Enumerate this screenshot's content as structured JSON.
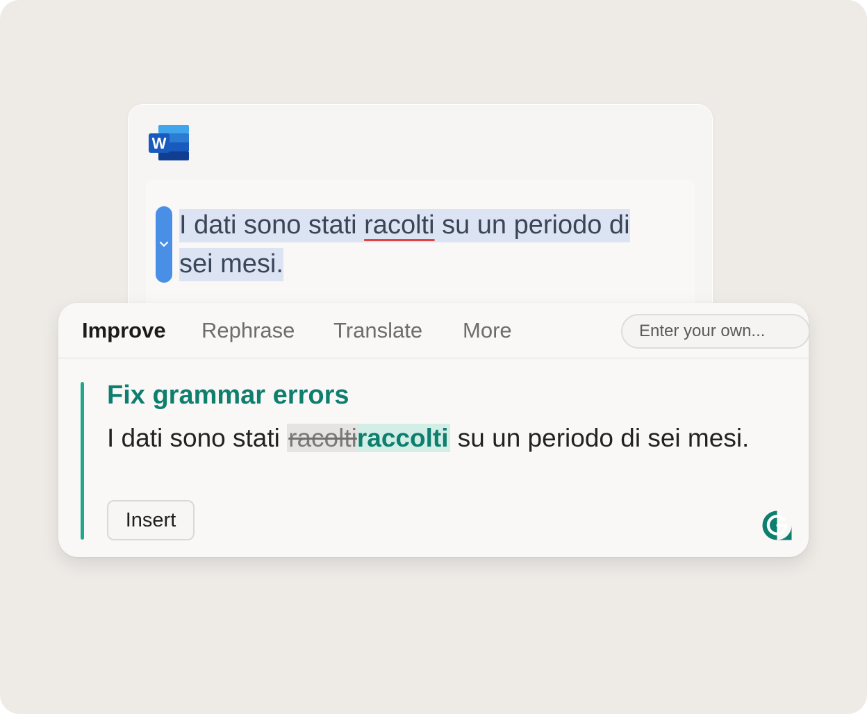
{
  "document": {
    "app_icon": "word-icon",
    "app_icon_letter": "W",
    "text_before": "I dati sono stati ",
    "error_word": "racolti",
    "text_after": " su un periodo di sei mesi.",
    "error_underline_color": "#e5413f",
    "selection_color": "#dce4f4",
    "handle_color": "#4a8fe6",
    "handle_icon": "chevron-down-icon"
  },
  "popup": {
    "tabs": [
      {
        "label": "Improve",
        "active": true
      },
      {
        "label": "Rephrase",
        "active": false
      },
      {
        "label": "Translate",
        "active": false
      },
      {
        "label": "More",
        "active": false
      }
    ],
    "own_prompt_placeholder": "Enter your own...",
    "suggestion": {
      "title": "Fix grammar errors",
      "text_before": "I dati sono stati ",
      "deleted": "racolti",
      "inserted": "raccolti",
      "text_after": " su un periodo di sei mesi.",
      "accent_color": "#1fa88f"
    },
    "insert_label": "Insert",
    "brand_icon": "grammarly-logo-icon",
    "brand_color": "#0e7e6e"
  }
}
